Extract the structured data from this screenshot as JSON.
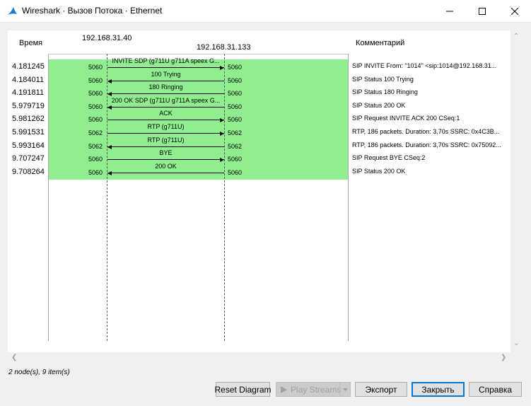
{
  "window": {
    "title": "Wireshark · Вызов Потока · Ethernet"
  },
  "columns": {
    "time": "Время",
    "comment": "Комментарий"
  },
  "nodes": [
    "192.168.31.40",
    "192.168.31.133"
  ],
  "rows": [
    {
      "time": "4.181245",
      "src_port": "5060",
      "dst_port": "5060",
      "label": "INVITE SDP (g711U g711A speex G...",
      "direction": "right",
      "comment": "SIP INVITE From: \"1014\" <sip:1014@192.168.31..."
    },
    {
      "time": "4.184011",
      "src_port": "5060",
      "dst_port": "5060",
      "label": "100 Trying",
      "direction": "left",
      "comment": "SIP Status 100 Trying"
    },
    {
      "time": "4.191811",
      "src_port": "5060",
      "dst_port": "5060",
      "label": "180 Ringing",
      "direction": "left",
      "comment": "SIP Status 180 Ringing"
    },
    {
      "time": "5.979719",
      "src_port": "5060",
      "dst_port": "5060",
      "label": "200 OK SDP (g711U g711A speex G...",
      "direction": "left",
      "comment": "SIP Status 200 OK"
    },
    {
      "time": "5.981262",
      "src_port": "5060",
      "dst_port": "5060",
      "label": "ACK",
      "direction": "right",
      "comment": "SIP Request INVITE ACK 200 CSeq:1"
    },
    {
      "time": "5.991531",
      "src_port": "5062",
      "dst_port": "5062",
      "label": "RTP (g711U)",
      "direction": "right",
      "comment": "RTP, 186 packets. Duration: 3,70s SSRC: 0x4C3B..."
    },
    {
      "time": "5.993164",
      "src_port": "5062",
      "dst_port": "5062",
      "label": "RTP (g711U)",
      "direction": "left",
      "comment": "RTP, 186 packets. Duration: 3,70s SSRC: 0x75092..."
    },
    {
      "time": "9.707247",
      "src_port": "5060",
      "dst_port": "5060",
      "label": "BYE",
      "direction": "right",
      "comment": "SIP Request BYE CSeq:2"
    },
    {
      "time": "9.708264",
      "src_port": "5060",
      "dst_port": "5060",
      "label": "200 OK",
      "direction": "left",
      "comment": "SIP Status 200 OK"
    }
  ],
  "status": "2 node(s), 9 item(s)",
  "buttons": {
    "reset": "Reset Diagram",
    "play": "Play Streams",
    "export": "Экспорт",
    "close": "Закрыть",
    "help": "Справка"
  },
  "colors": {
    "flow_background": "#90ee90",
    "accent": "#0078d7"
  }
}
